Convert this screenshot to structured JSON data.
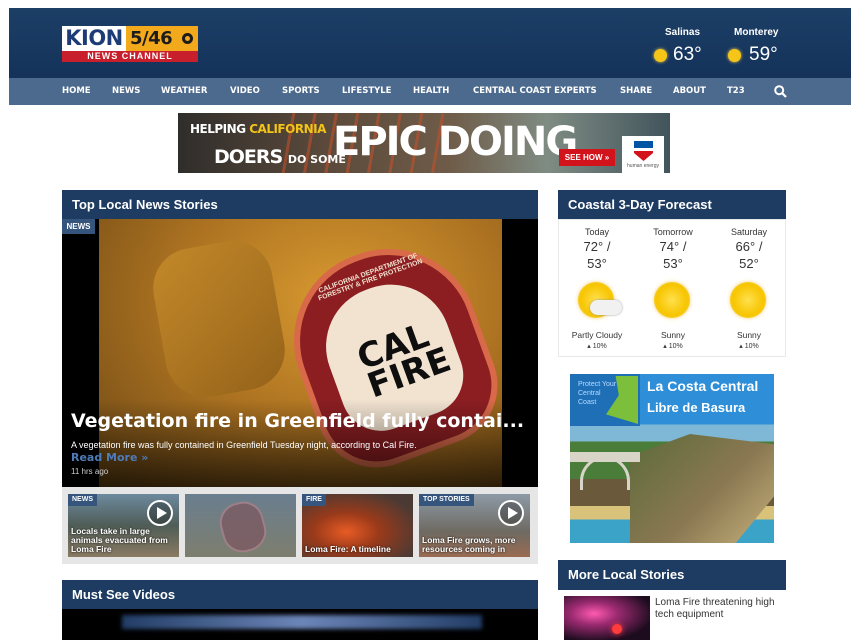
{
  "header": {
    "logo": {
      "kion": "KION",
      "channel": "5/46",
      "news_channel": "NEWS CHANNEL"
    },
    "weather": [
      {
        "city": "Salinas",
        "temp": "63°"
      },
      {
        "city": "Monterey",
        "temp": "59°"
      }
    ]
  },
  "nav": {
    "items": [
      "HOME",
      "NEWS",
      "WEATHER",
      "VIDEO",
      "SPORTS",
      "LIFESTYLE",
      "HEALTH",
      "CENTRAL COAST EXPERTS",
      "SHARE",
      "ABOUT",
      "T23"
    ]
  },
  "ad": {
    "line1_a": "HELPING ",
    "line1_b": "CALIFORNIA",
    "line2_a": "DOERS",
    "line2_b": "DO SOME",
    "headline": "EPIC DOING",
    "cta": "SEE HOW »",
    "brand_tag": "human energy"
  },
  "top_stories": {
    "heading": "Top Local News Stories",
    "hero": {
      "tag": "NEWS",
      "patch_top": "CALIFORNIA DEPARTMENT OF FORESTRY & FIRE PROTECTION",
      "patch_word1": "CAL",
      "patch_word2": "FIRE",
      "title": "Vegetation fire in Greenfield fully contai...",
      "summary": "A vegetation fire was fully contained in Greenfield Tuesday night, according to Cal Fire.",
      "read_more": "Read More »",
      "time": "11 hrs ago"
    },
    "thumbs": [
      {
        "tag": "NEWS",
        "caption": "Locals take in large animals evacuated from Loma Fire"
      },
      {
        "tag": "",
        "caption": ""
      },
      {
        "tag": "FIRE",
        "caption": "Loma Fire: A timeline"
      },
      {
        "tag": "TOP STORIES",
        "caption": "Loma Fire grows, more resources coming in"
      }
    ]
  },
  "must_see": {
    "heading": "Must See Videos"
  },
  "forecast": {
    "heading": "Coastal 3-Day Forecast",
    "days": [
      {
        "name": "Today",
        "hi": "72° /",
        "lo": "53°",
        "condition": "Partly Cloudy",
        "precip": "▴ 10%",
        "icon": "partly-cloudy-icon"
      },
      {
        "name": "Tomorrow",
        "hi": "74° /",
        "lo": "53°",
        "condition": "Sunny",
        "precip": "▴ 10%",
        "icon": "sunny-icon"
      },
      {
        "name": "Saturday",
        "hi": "66° /",
        "lo": "52°",
        "condition": "Sunny",
        "precip": "▴ 10%",
        "icon": "sunny-icon"
      }
    ]
  },
  "side_ad": {
    "protect": "Protect Your Central Coast",
    "title1": "La Costa Central",
    "title2": "Libre de Basura"
  },
  "more_local": {
    "heading": "More Local Stories",
    "items": [
      {
        "title": "Loma Fire threatening high tech equipment"
      }
    ]
  },
  "colors": {
    "header_bg": "#1c3f66",
    "nav_bg": "#4c6a8e",
    "section_header": "#1e3c61",
    "accent_link": "#4d7cb8"
  }
}
